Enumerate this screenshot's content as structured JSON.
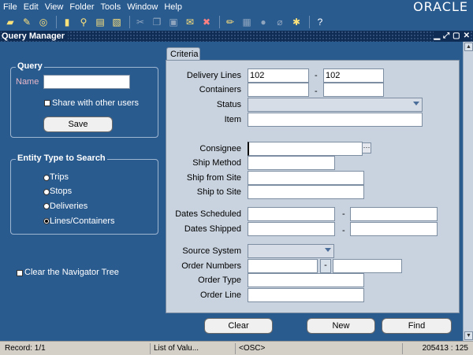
{
  "menubar": {
    "items": [
      "File",
      "Edit",
      "View",
      "Folder",
      "Tools",
      "Window",
      "Help"
    ],
    "logo": "ORACLE"
  },
  "toolbar": {
    "icons": [
      "new-icon",
      "navigator-icon",
      "zoom-icon",
      "open-folder-icon",
      "find-icon",
      "print-icon",
      "save-folder-icon",
      "cut-icon",
      "copy-icon",
      "paste-icon",
      "new-record-icon",
      "delete-record-icon",
      "edit-icon",
      "attachment-icon",
      "clear-icon",
      "folder-tools-icon",
      "help-icon"
    ]
  },
  "window": {
    "title": "Query Manager"
  },
  "query_group": {
    "legend": "Query",
    "name_label": "Name",
    "name_value": "",
    "share_label": "Share with other users",
    "share_checked": false,
    "save_label": "Save"
  },
  "entity_group": {
    "legend": "Entity Type to Search",
    "options": [
      "Trips",
      "Stops",
      "Deliveries",
      "Lines/Containers"
    ],
    "selected": "Lines/Containers"
  },
  "clear_tree": {
    "label": "Clear the Navigator Tree",
    "checked": false
  },
  "criteria": {
    "tab_label": "Criteria",
    "delivery_lines_label": "Delivery Lines",
    "delivery_lines_from": "102",
    "delivery_lines_to": "102",
    "containers_label": "Containers",
    "containers_from": "",
    "containers_to": "",
    "status_label": "Status",
    "status_value": "",
    "item_label": "Item",
    "item_value": "",
    "consignee_label": "Consignee",
    "consignee_value": "",
    "ship_method_label": "Ship Method",
    "ship_method_value": "",
    "ship_from_label": "Ship from Site",
    "ship_from_value": "",
    "ship_to_label": "Ship to Site",
    "ship_to_value": "",
    "dates_scheduled_label": "Dates Scheduled",
    "dates_shipped_label": "Dates Shipped",
    "source_system_label": "Source System",
    "source_system_value": "",
    "order_numbers_label": "Order Numbers",
    "order_type_label": "Order Type",
    "order_line_label": "Order Line",
    "dash": "-"
  },
  "buttons": {
    "clear": "Clear",
    "new": "New",
    "find": "Find"
  },
  "statusbar": {
    "record": "Record: 1/1",
    "lov": "List of Valu...",
    "osc": "<OSC>",
    "position": "205413 : 125"
  }
}
